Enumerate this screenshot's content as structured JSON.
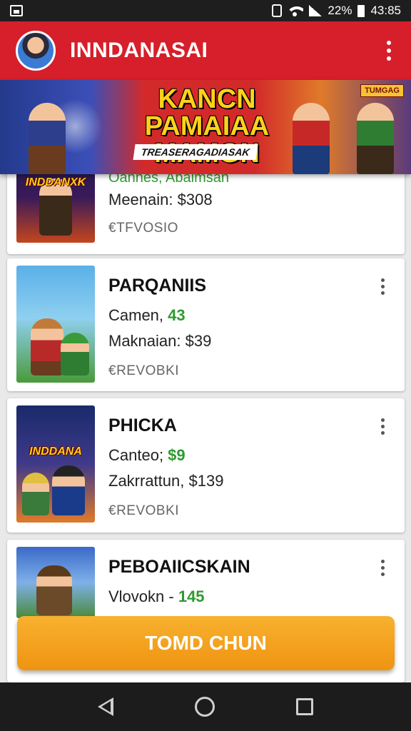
{
  "status_bar": {
    "battery_percent": "22%",
    "time": "43:85",
    "icons": [
      "screenshot-icon",
      "vibrate-icon",
      "wifi-icon",
      "signal-icon",
      "battery-icon"
    ]
  },
  "app_bar": {
    "title": "INNDANASAI",
    "menu_icon": "overflow-menu-icon"
  },
  "banner": {
    "title_line1": "KANCN PAMAIAA",
    "title_line2": "MAMGN",
    "subtitle": "TREASERAGADIASAK",
    "corner_tag": "TUMGAG"
  },
  "cards": [
    {
      "thumb_label": "INDDANXK",
      "line_top": "Oannes, Abaimsan",
      "line2": "Meenain: $308",
      "code": "€TFVOSIO"
    },
    {
      "thumb_label": "",
      "title": "PARQANIIS",
      "line1_prefix": "Camen, ",
      "line1_value": "43",
      "line2": "Maknaian: $39",
      "code": "€REVOBKI"
    },
    {
      "thumb_label": "INDDANA",
      "title": "PHICKA",
      "line1_prefix": "Canteo; ",
      "line1_value": "$9",
      "line2": "Zakrrattun, $139",
      "code": "€REVOBKI"
    },
    {
      "thumb_label": "",
      "title": "PEBOAIICSKAIN",
      "line1_prefix": "Vlovokn - ",
      "line1_value": "145"
    }
  ],
  "cta": {
    "label": "TOMD CHUN"
  },
  "colors": {
    "app_bar": "#d61f2a",
    "cta": "#f5a623",
    "accent_green": "#2e9b2e"
  }
}
